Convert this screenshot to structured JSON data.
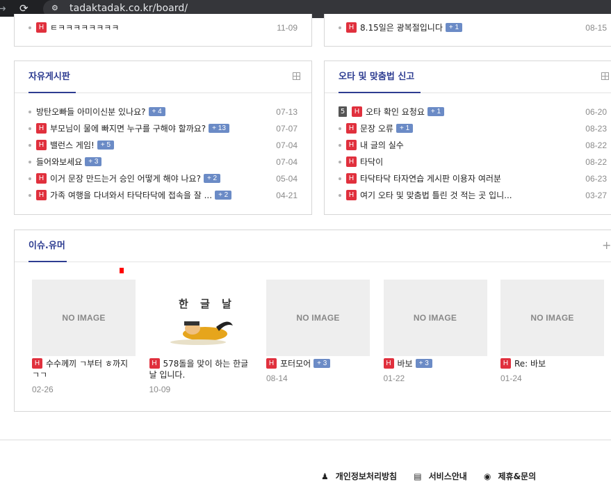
{
  "browser": {
    "url": "tadaktadak.co.kr/board/"
  },
  "top_partial": {
    "left": {
      "title": "ㅌㅋㅋㅋㅋㅋㅋㅋㅋ",
      "date": "11-09"
    },
    "right": {
      "title": "8.15일은 광복절입니다",
      "count": "+ 1",
      "date": "08-15"
    }
  },
  "free_board": {
    "title": "자유게시판",
    "posts": [
      {
        "badge": "",
        "title": "방탄오빠들 아미이신분 있나요?",
        "count": "+ 4",
        "date": "07-13"
      },
      {
        "badge": "H",
        "title": "부모님이 물에 빠지면 누구를 구해야 할까요?",
        "count": "+ 13",
        "date": "07-07"
      },
      {
        "badge": "H",
        "title": "밸런스 게임!",
        "count": "+ 5",
        "date": "07-04"
      },
      {
        "badge": "",
        "title": "들어와보세요",
        "count": "+ 3",
        "date": "07-04"
      },
      {
        "badge": "H",
        "title": "이거 문장 만드는거 승인 어떻게 해야 나요?",
        "count": "+ 2",
        "date": "05-04"
      },
      {
        "badge": "H",
        "title": "가족 여행을 다녀와서 타닥타닥에 접속을 잘 ...",
        "count": "+ 2",
        "date": "04-21"
      }
    ]
  },
  "typo_board": {
    "title": "오타 및 맞춤법 신고",
    "posts": [
      {
        "rank": "5",
        "badge": "H",
        "title": "오타 확인 요청요",
        "count": "+ 1",
        "date": "06-20"
      },
      {
        "badge": "H",
        "title": "문장 오류",
        "count": "+ 1",
        "date": "08-23"
      },
      {
        "badge": "H",
        "title": "내 글의 실수",
        "count": "",
        "date": "08-22"
      },
      {
        "badge": "H",
        "title": "타닥이",
        "count": "",
        "date": "08-22"
      },
      {
        "badge": "H",
        "title": "타닥타닥 타자연습 게시판 이용자 여러분",
        "count": "",
        "date": "06-23"
      },
      {
        "badge": "H",
        "title": "여기 오타 및 맞춤법 틀린 것 적는 곳 입니...",
        "count": "",
        "date": "03-27"
      }
    ]
  },
  "issue_board": {
    "title": "이슈.유머",
    "items": [
      {
        "thumb": "NO IMAGE",
        "badge": "H",
        "title": "수수께끼 ㄱ부터 ㅎ까지 ㄱㄱ",
        "count": "",
        "date": "02-26"
      },
      {
        "thumb": "",
        "art_text": "한 글 날",
        "badge": "H",
        "title": "578돌을 맞이 하는 한글날 입니다.",
        "count": "",
        "date": "10-09"
      },
      {
        "thumb": "NO IMAGE",
        "badge": "H",
        "title": "포터모어",
        "count": "+ 3",
        "date": "08-14"
      },
      {
        "thumb": "NO IMAGE",
        "badge": "H",
        "title": "바보",
        "count": "+ 3",
        "date": "01-22"
      },
      {
        "thumb": "NO IMAGE",
        "badge": "H",
        "title": "Re: 바보",
        "count": "",
        "date": "01-24"
      }
    ]
  },
  "footer": {
    "links": [
      "개인정보처리방침",
      "서비스안내",
      "제휴&문의"
    ]
  },
  "colors": {
    "accent": "#2d3c91",
    "hot_badge": "#e0303d",
    "comment_badge": "#6b8bc6"
  }
}
